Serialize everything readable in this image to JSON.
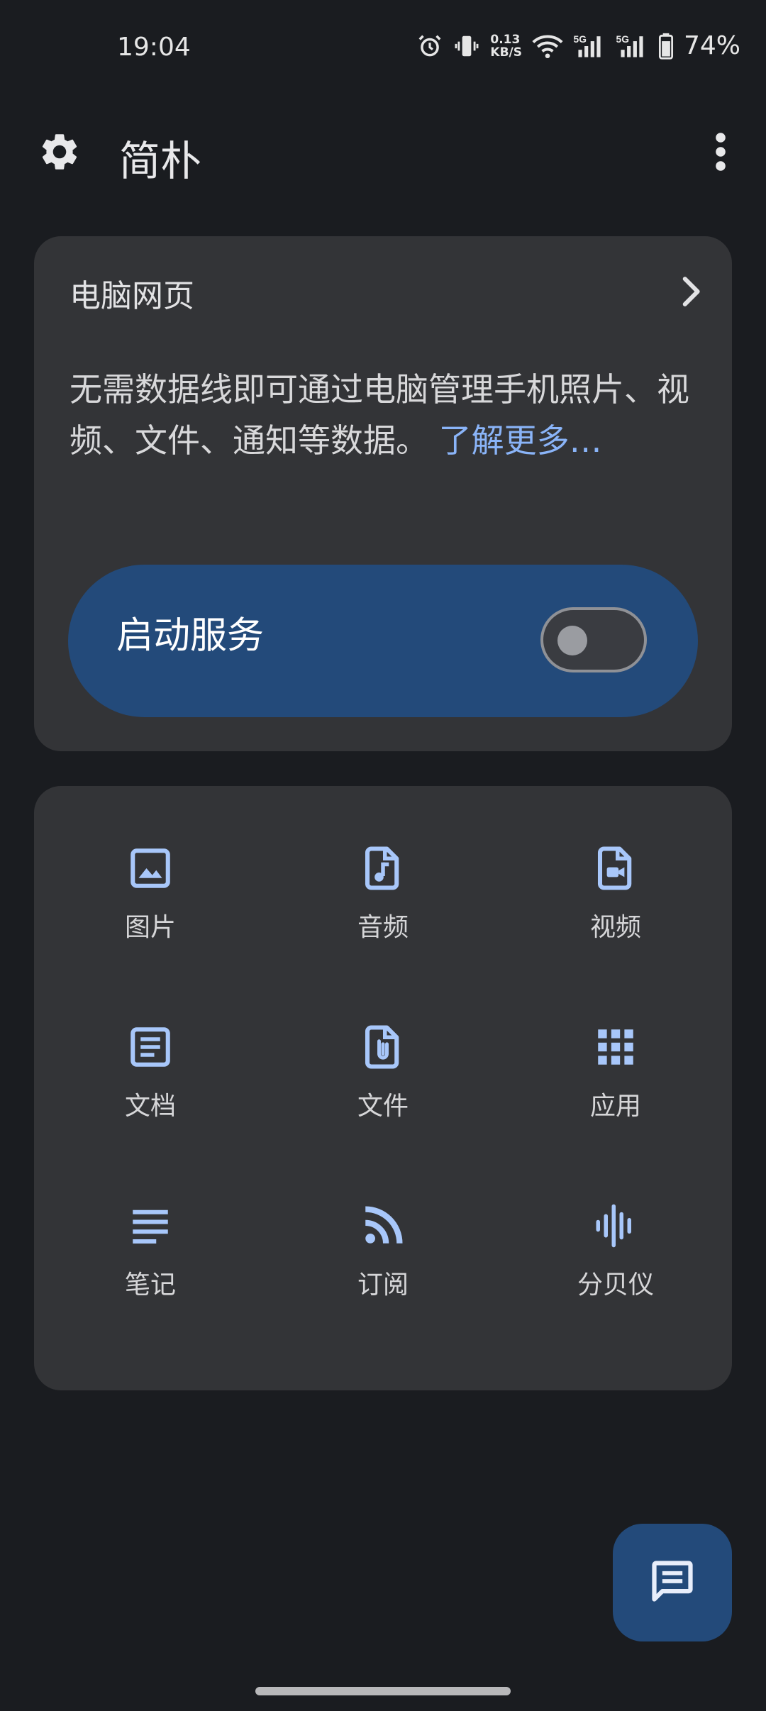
{
  "status_bar": {
    "time": "19:04",
    "net_speed_value": "0.13",
    "net_speed_unit": "KB/S",
    "sim1_label": "5G",
    "sim2_label": "5G",
    "battery": "74%"
  },
  "app_bar": {
    "title": "简朴"
  },
  "web_card": {
    "title": "电脑网页",
    "description": "无需数据线即可通过电脑管理手机照片、视频、文件、通知等数据。",
    "learn_more": "了解更多…",
    "service_label": "启动服务",
    "service_enabled": false
  },
  "grid": {
    "items": [
      {
        "label": "图片",
        "icon": "image-icon"
      },
      {
        "label": "音频",
        "icon": "audio-file-icon"
      },
      {
        "label": "视频",
        "icon": "video-file-icon"
      },
      {
        "label": "文档",
        "icon": "document-icon"
      },
      {
        "label": "文件",
        "icon": "attachment-file-icon"
      },
      {
        "label": "应用",
        "icon": "apps-grid-icon"
      },
      {
        "label": "笔记",
        "icon": "notes-icon"
      },
      {
        "label": "订阅",
        "icon": "rss-feed-icon"
      },
      {
        "label": "分贝仪",
        "icon": "sound-meter-icon"
      }
    ]
  },
  "colors": {
    "background": "#1a1c20",
    "card": "#333437",
    "accent_panel": "#234a7a",
    "icon_blue": "#a8c7fa",
    "link": "#8ab4f8"
  }
}
